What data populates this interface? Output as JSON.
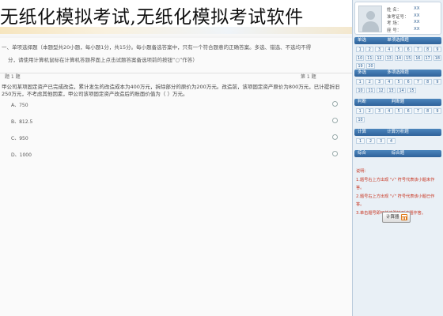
{
  "banner": {
    "title": "无纸化模拟考试,无纸化模拟考试软件"
  },
  "instructions": {
    "line1": "一、单项选择题（本题型共20小题，每小题1分，共15分。每小题备选答案中，只有一个符合题意的正确答案。多选、错选、不选均不得",
    "line2": "分，请使用计算机鼠标在计算机答题界面上点击试题答案备选项前的按钮“○”作答）"
  },
  "question": {
    "header_left": "题 1 题",
    "header_no": "第 1 题",
    "text": "甲公司某项固定资产已完成改造，累计发生的改造成本为400万元，拆除部分的原价为200万元。改造前，该项固定资产原价为800万元，已计提折旧250万元，不考虑其他因素，甲公司该项固定资产改造后的账面价值为（    ）万元。",
    "options": [
      {
        "label": "A、750"
      },
      {
        "label": "B、812.5"
      },
      {
        "label": "C、950"
      },
      {
        "label": "D、1000"
      }
    ]
  },
  "sidebar": {
    "info": [
      {
        "k": "姓    名：",
        "v": "XX"
      },
      {
        "k": "准考证号：",
        "v": "XX"
      },
      {
        "k": "考    场：",
        "v": "XX"
      },
      {
        "k": "座    号：",
        "v": "XX"
      }
    ],
    "sections": [
      {
        "title": "单项选择题",
        "short": "单选",
        "rows": [
          [
            "1",
            "2",
            "3",
            "4",
            "5",
            "6",
            "7",
            "8",
            "9"
          ],
          [
            "10",
            "11",
            "12",
            "13",
            "14",
            "15",
            "16",
            "17",
            "18"
          ],
          [
            "19",
            "20"
          ]
        ]
      },
      {
        "title": "多项选择题",
        "short": "多选",
        "rows": [
          [
            "1",
            "2",
            "3",
            "4",
            "5",
            "6",
            "7",
            "8",
            "9"
          ],
          [
            "10",
            "11",
            "12",
            "13",
            "14",
            "15"
          ]
        ]
      },
      {
        "title": "判断题",
        "short": "判断",
        "rows": [
          [
            "1",
            "2",
            "3",
            "4",
            "5",
            "6",
            "7",
            "8",
            "9"
          ],
          [
            "10"
          ]
        ]
      },
      {
        "title": "计算分析题",
        "short": "计算",
        "rows": [
          [
            "1",
            "2",
            "3",
            "4"
          ]
        ]
      },
      {
        "title": "综合题",
        "short": "综合",
        "rows": []
      }
    ],
    "help_lines": [
      "说明：",
      "1.题号右上方出现 \"√\" 符号代表该小题未作答。",
      "2.题号右上方出现 \"√\" 符号代表该小题已作答。",
      "3.单击题号即可快速跳转到该题作答。"
    ],
    "calculator_label": "计算器"
  }
}
